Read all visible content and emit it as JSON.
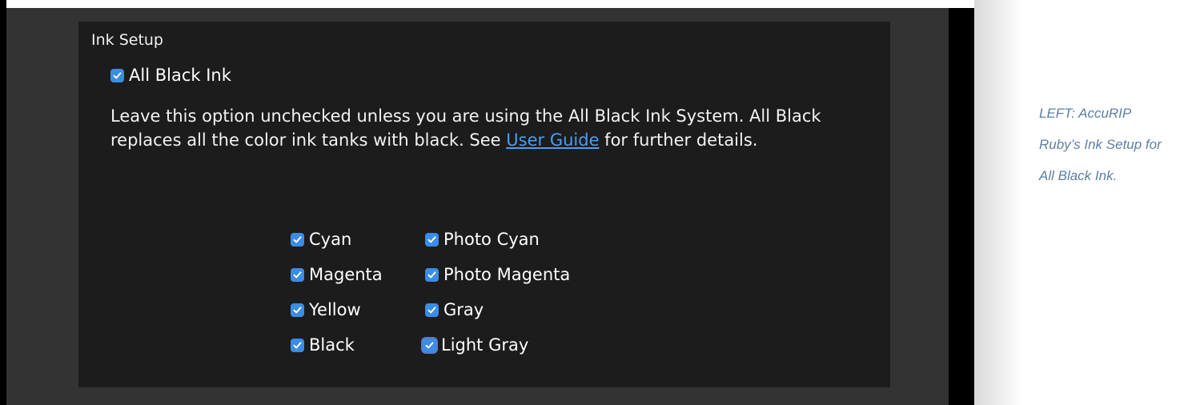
{
  "panel": {
    "section_title": "Ink Setup",
    "all_black": {
      "label": "All Black Ink",
      "checked": true
    },
    "description": {
      "before_link": "Leave this option unchecked unless you are using the All Black Ink System. All Black replaces all the color ink tanks with black. See ",
      "link_text": "User Guide",
      "after_link": " for further details."
    },
    "inks_left": [
      {
        "label": "Cyan",
        "checked": true
      },
      {
        "label": "Magenta",
        "checked": true
      },
      {
        "label": "Yellow",
        "checked": true
      },
      {
        "label": "Black",
        "checked": true
      }
    ],
    "inks_right": [
      {
        "label": "Photo Cyan",
        "checked": true
      },
      {
        "label": "Photo Magenta",
        "checked": true
      },
      {
        "label": "Gray",
        "checked": true
      },
      {
        "label": "Light Gray",
        "checked": true,
        "focused": true
      }
    ]
  },
  "caption": {
    "line1": "LEFT:  AccuRIP",
    "line2": "Ruby’s Ink Setup for",
    "line3": "All Black Ink."
  },
  "colors": {
    "checkbox": "#3b8de6",
    "link": "#4a9ef0",
    "panel_bg": "#1c1c1c",
    "outer_bg": "#333333",
    "caption": "#5b7fa3"
  }
}
